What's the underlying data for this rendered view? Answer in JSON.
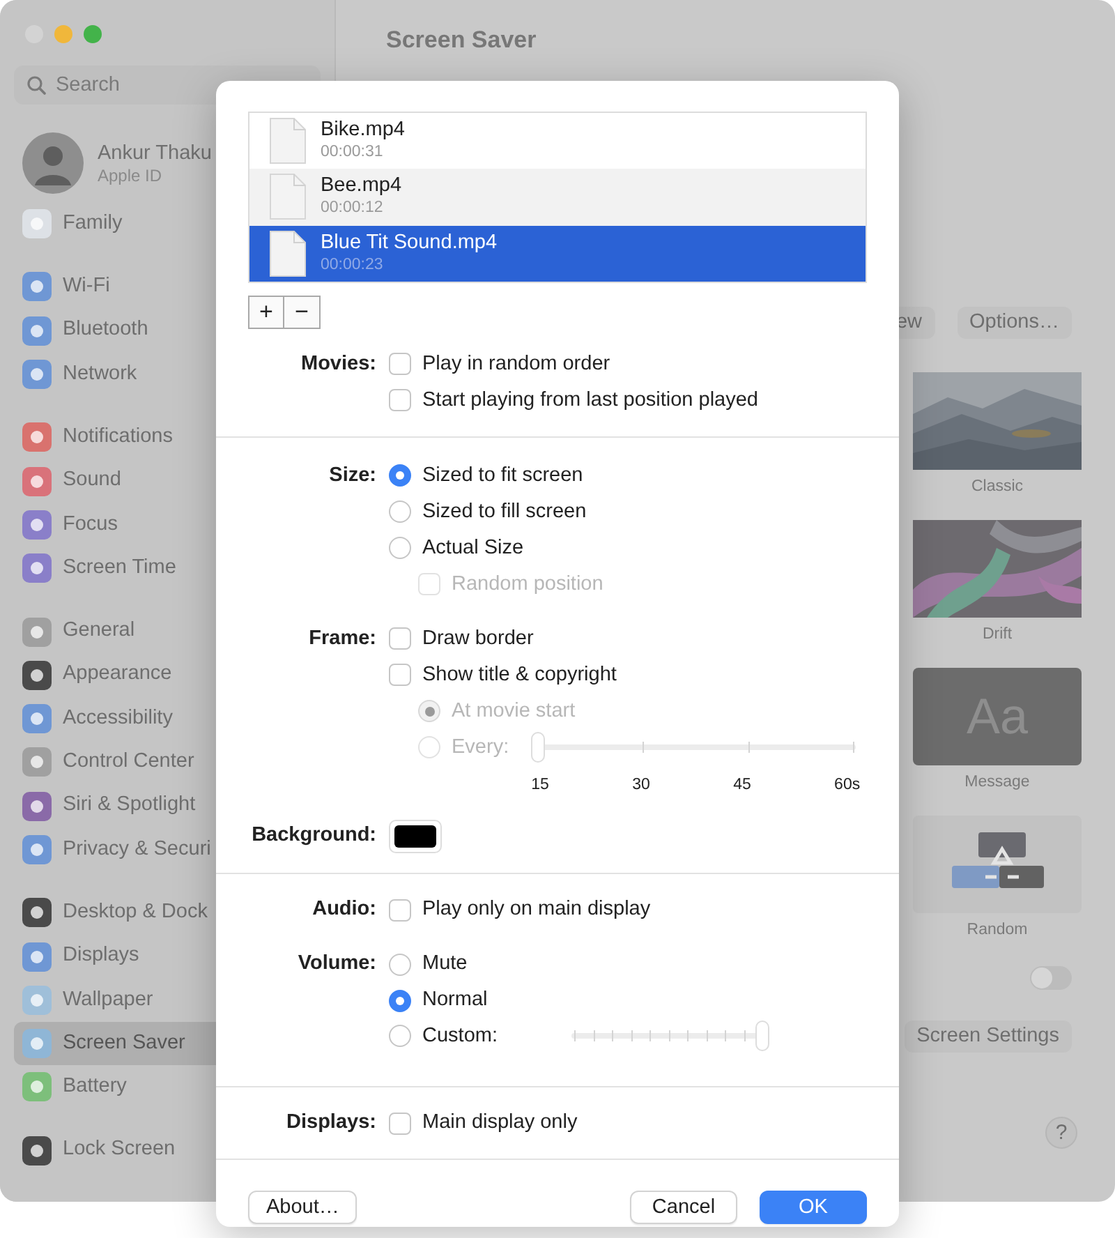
{
  "sidebar": {
    "search": {
      "placeholder": "Search"
    },
    "account": {
      "name": "Ankur Thaku",
      "subtitle": "Apple ID"
    },
    "groups": [
      [
        {
          "label": "Family",
          "color": "#dde1e6",
          "selected": false
        }
      ],
      [
        {
          "label": "Wi-Fi",
          "color": "#6f97d4",
          "selected": false
        },
        {
          "label": "Bluetooth",
          "color": "#6f97d4",
          "selected": false
        },
        {
          "label": "Network",
          "color": "#6f97d4",
          "selected": false
        }
      ],
      [
        {
          "label": "Notifications",
          "color": "#d9726e",
          "selected": false
        },
        {
          "label": "Sound",
          "color": "#d9727a",
          "selected": false
        },
        {
          "label": "Focus",
          "color": "#8a7fc9",
          "selected": false
        },
        {
          "label": "Screen Time",
          "color": "#8a7fc9",
          "selected": false
        }
      ],
      [
        {
          "label": "General",
          "color": "#a0a0a0",
          "selected": false
        },
        {
          "label": "Appearance",
          "color": "#4a4a4a",
          "selected": false
        },
        {
          "label": "Accessibility",
          "color": "#6f97d4",
          "selected": false
        },
        {
          "label": "Control Center",
          "color": "#a0a0a0",
          "selected": false
        },
        {
          "label": "Siri & Spotlight",
          "color": "#8a6aa8",
          "selected": false
        },
        {
          "label": "Privacy & Securi",
          "color": "#6f97d4",
          "selected": false
        }
      ],
      [
        {
          "label": "Desktop & Dock",
          "color": "#4a4a4a",
          "selected": false
        },
        {
          "label": "Displays",
          "color": "#6f97d4",
          "selected": false
        },
        {
          "label": "Wallpaper",
          "color": "#9fbfd9",
          "selected": false
        },
        {
          "label": "Screen Saver",
          "color": "#8fb6d6",
          "selected": true
        },
        {
          "label": "Battery",
          "color": "#7dbf7b",
          "selected": false
        }
      ],
      [
        {
          "label": "Lock Screen",
          "color": "#4a4a4a",
          "selected": false
        }
      ]
    ]
  },
  "main": {
    "title": "Screen Saver",
    "buttons": [
      "ew",
      "Options…"
    ],
    "savers": [
      {
        "label": "Classic",
        "kind": "classic"
      },
      {
        "label": "Drift",
        "kind": "drift"
      },
      {
        "label": "Message",
        "kind": "message",
        "text": "Aa"
      },
      {
        "label": "Random",
        "kind": "random"
      }
    ],
    "toggle": {
      "on": false
    },
    "settings_button": "Screen Settings",
    "help": "?"
  },
  "dialog": {
    "files": [
      {
        "name": "Bike.mp4",
        "duration": "00:00:31",
        "selected": false
      },
      {
        "name": "Bee.mp4",
        "duration": "00:00:12",
        "selected": false
      },
      {
        "name": "Blue Tit Sound.mp4",
        "duration": "00:00:23",
        "selected": true
      }
    ],
    "list_buttons": [
      "+",
      "−"
    ],
    "sections": [
      {
        "rows": [
          {
            "label": "Movies:",
            "options": [
              {
                "kind": "checkbox",
                "text": "Play in random order",
                "checked": false,
                "disabled": false
              },
              {
                "kind": "checkbox",
                "text": "Start playing from last position played",
                "checked": false,
                "disabled": false
              }
            ]
          }
        ]
      },
      {
        "rows": [
          {
            "label": "Size:",
            "options": [
              {
                "kind": "radio",
                "text": "Sized to fit screen",
                "selected": true,
                "disabled": false
              },
              {
                "kind": "radio",
                "text": "Sized to fill screen",
                "selected": false,
                "disabled": false
              },
              {
                "kind": "radio",
                "text": "Actual Size",
                "selected": false,
                "disabled": false,
                "children": [
                  {
                    "kind": "checkbox",
                    "text": "Random position",
                    "checked": false,
                    "disabled": true
                  }
                ]
              }
            ]
          },
          {
            "label": "Frame:",
            "options": [
              {
                "kind": "checkbox",
                "text": "Draw border",
                "checked": false,
                "disabled": false
              },
              {
                "kind": "checkbox",
                "text": "Show title & copyright",
                "checked": false,
                "disabled": false,
                "children": [
                  {
                    "kind": "radio",
                    "text": "At movie start",
                    "selected": true,
                    "disabled": true
                  },
                  {
                    "kind": "radio",
                    "text": "Every:",
                    "selected": false,
                    "disabled": true,
                    "slider": {
                      "level": 0,
                      "disabled": true,
                      "ticks": [
                        "15",
                        "30",
                        "45",
                        "60s"
                      ]
                    }
                  }
                ]
              }
            ]
          },
          {
            "label": "Background:",
            "options": [
              {
                "kind": "swatch",
                "color": "#000000"
              }
            ]
          }
        ]
      },
      {
        "rows": [
          {
            "label": "Audio:",
            "options": [
              {
                "kind": "checkbox",
                "text": "Play only on main display",
                "checked": false,
                "disabled": false
              }
            ]
          },
          {
            "label": "Volume:",
            "options": [
              {
                "kind": "radio",
                "text": "Mute",
                "selected": false,
                "disabled": false
              },
              {
                "kind": "radio",
                "text": "Normal",
                "selected": true,
                "disabled": false
              },
              {
                "kind": "radio",
                "text": "Custom:",
                "selected": false,
                "disabled": false,
                "slider": {
                  "level": 1,
                  "disabled": true
                }
              }
            ]
          }
        ]
      },
      {
        "rows": [
          {
            "label": "Displays:",
            "options": [
              {
                "kind": "checkbox",
                "text": "Main display only",
                "checked": false,
                "disabled": false
              }
            ]
          }
        ]
      }
    ],
    "footer": [
      {
        "label": "About…",
        "kind": "plain"
      },
      {
        "label": "Cancel",
        "kind": "plain"
      },
      {
        "label": "OK",
        "kind": "primary"
      }
    ]
  }
}
